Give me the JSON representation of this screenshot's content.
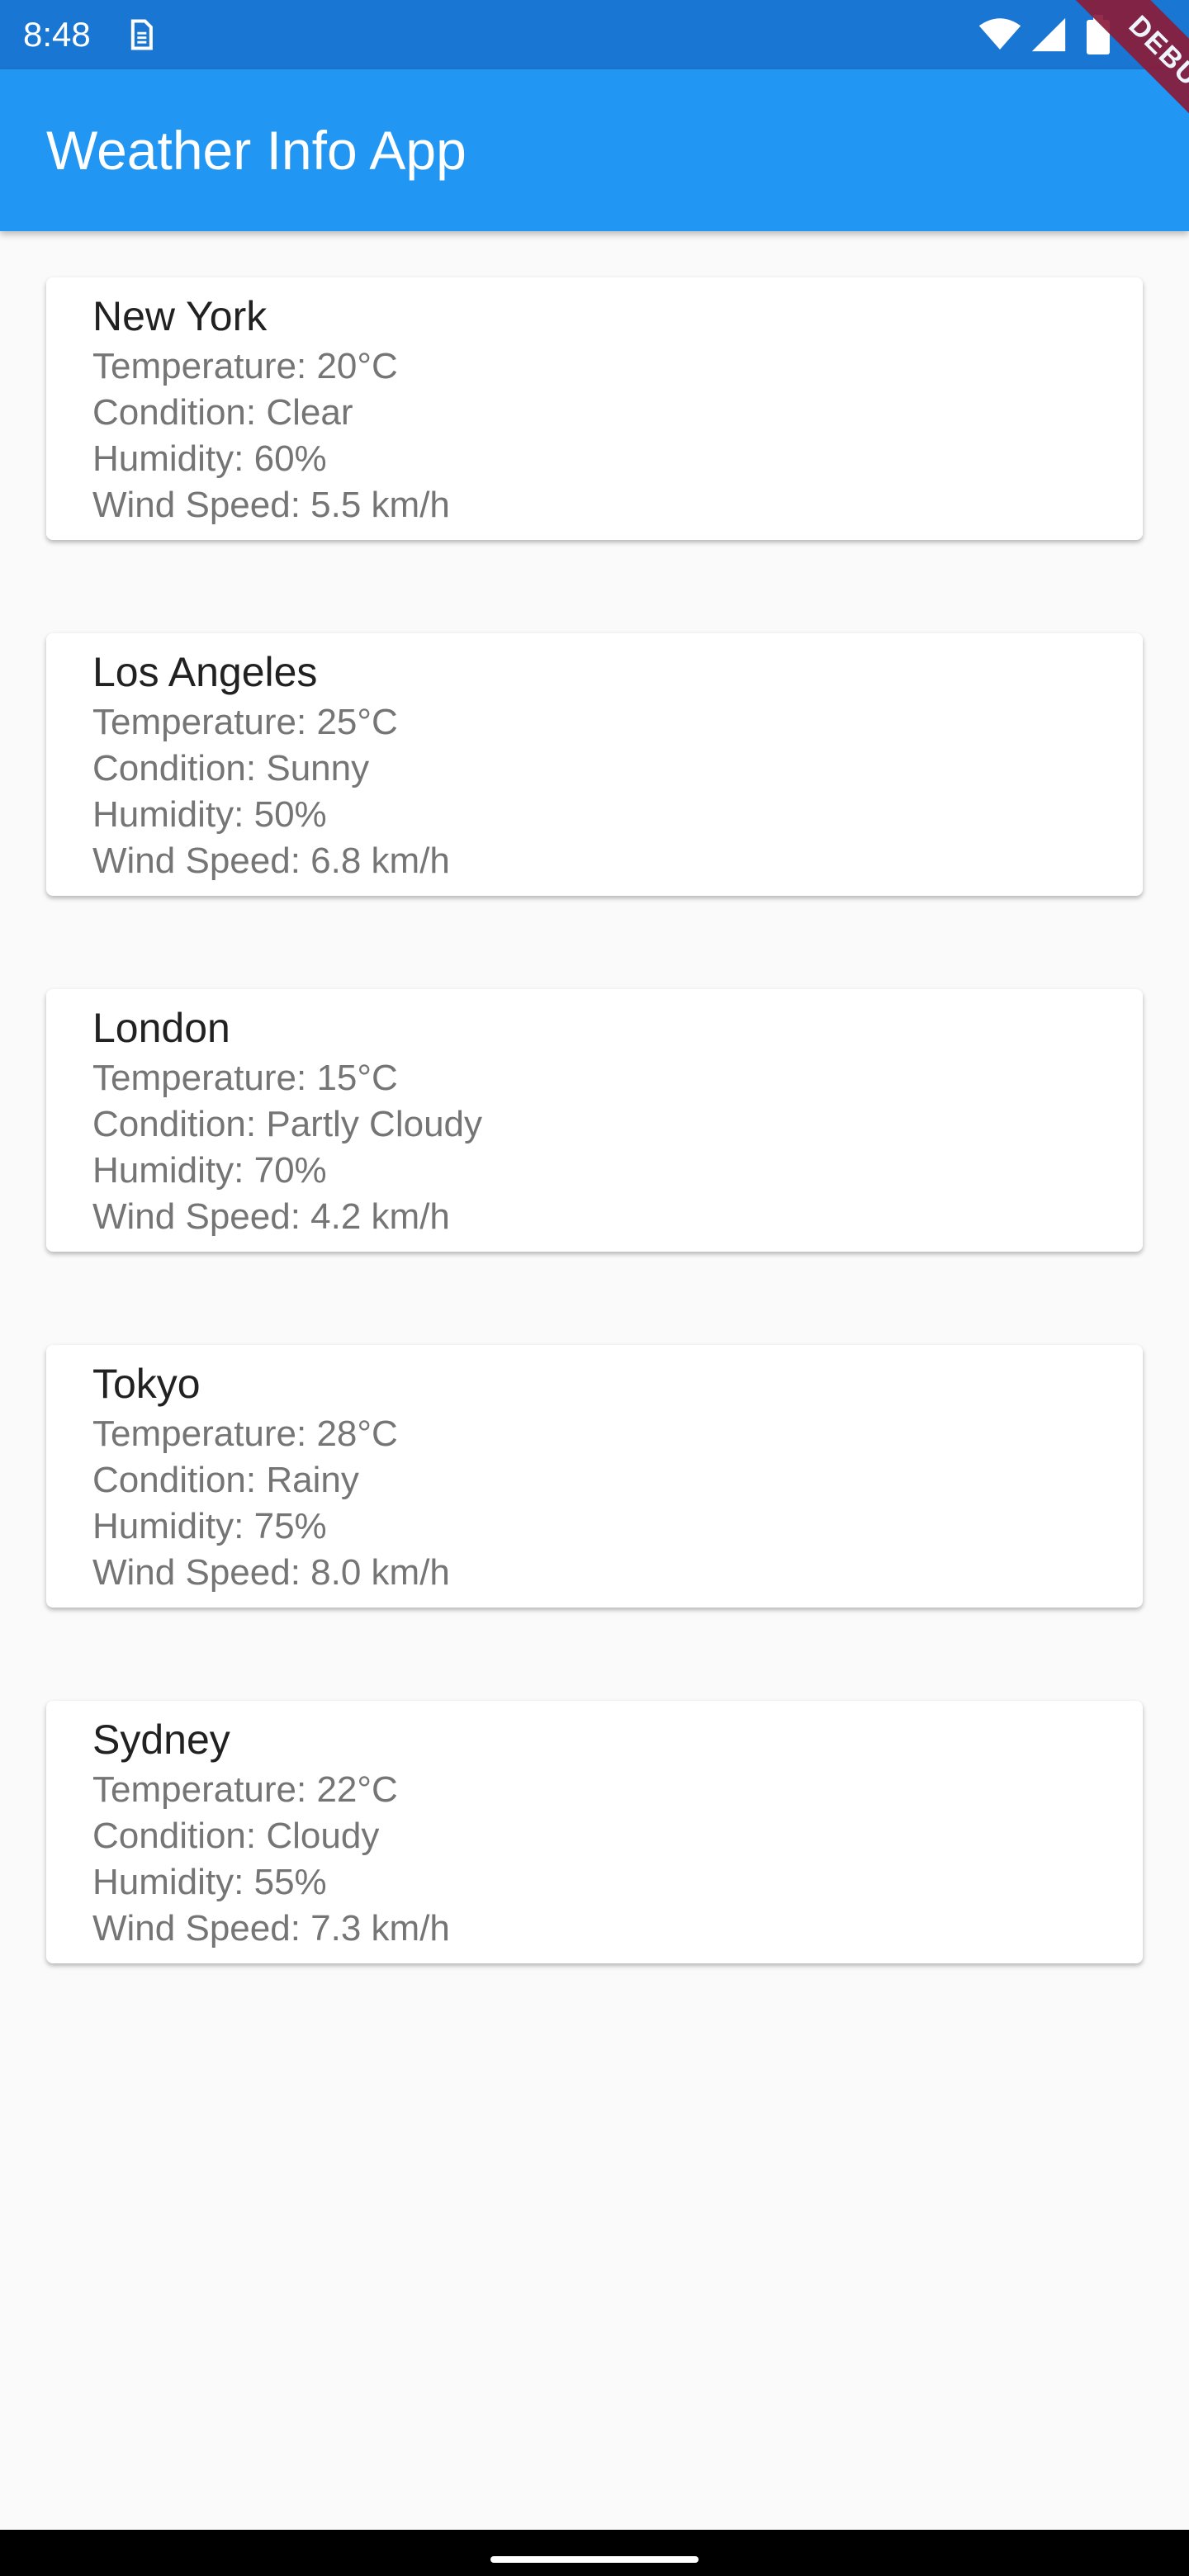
{
  "status_bar": {
    "time": "8:48",
    "icons": [
      "sim-card-icon",
      "wifi-icon",
      "signal-icon",
      "battery-icon"
    ],
    "background": "#1976d2"
  },
  "app_bar": {
    "title": "Weather Info App",
    "background": "#2196f3"
  },
  "debug_banner": {
    "label": "DEBUG",
    "color": "#8a1c3a"
  },
  "cities": [
    {
      "name": "New York",
      "temperature": "Temperature: 20°C",
      "condition": "Condition: Clear",
      "humidity": "Humidity: 60%",
      "wind_speed": "Wind Speed: 5.5 km/h"
    },
    {
      "name": "Los Angeles",
      "temperature": "Temperature: 25°C",
      "condition": "Condition: Sunny",
      "humidity": "Humidity: 50%",
      "wind_speed": "Wind Speed: 6.8 km/h"
    },
    {
      "name": "London",
      "temperature": "Temperature: 15°C",
      "condition": "Condition: Partly Cloudy",
      "humidity": "Humidity: 70%",
      "wind_speed": "Wind Speed: 4.2 km/h"
    },
    {
      "name": "Tokyo",
      "temperature": "Temperature: 28°C",
      "condition": "Condition: Rainy",
      "humidity": "Humidity: 75%",
      "wind_speed": "Wind Speed: 8.0 km/h"
    },
    {
      "name": "Sydney",
      "temperature": "Temperature: 22°C",
      "condition": "Condition: Cloudy",
      "humidity": "Humidity: 55%",
      "wind_speed": "Wind Speed: 7.3 km/h"
    }
  ]
}
